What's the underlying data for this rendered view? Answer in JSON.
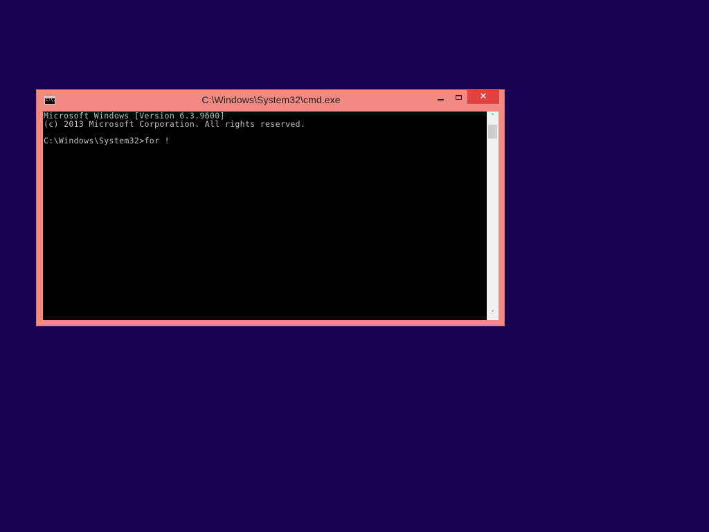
{
  "window": {
    "title": "C:\\Windows\\System32\\cmd.exe",
    "icon_label": "C:\\.",
    "icon": "cmd-icon"
  },
  "caption_buttons": {
    "minimize_icon": "minimize-icon",
    "maximize_icon": "maximize-icon",
    "close_icon": "close-icon",
    "close_glyph": "✕"
  },
  "console": {
    "lines": [
      "Microsoft Windows [Version 6.3.9600]",
      "(c) 2013 Microsoft Corporation. All rights reserved.",
      "",
      "C:\\Windows\\System32>for !"
    ]
  },
  "scrollbar": {
    "up_arrow": "˄",
    "down_arrow": "˅"
  },
  "colors": {
    "desktop": "#1a0050",
    "window_frame": "#f18a82",
    "close_button": "#e04343",
    "console_bg": "#000000",
    "console_text": "#c0c0c0"
  }
}
